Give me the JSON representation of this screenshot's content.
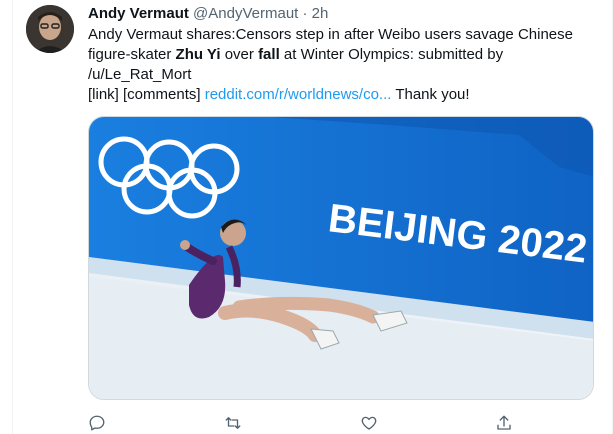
{
  "tweet": {
    "author_name": "Andy Vermaut",
    "author_handle": "@AndyVermaut",
    "separator": "·",
    "time": "2h",
    "text_part1": "Andy Vermaut shares:Censors step in after Weibo users savage Chinese figure-skater ",
    "bold1": "Zhu Yi",
    "text_part2": " over ",
    "bold2": "fall",
    "text_part3": " at Winter Olympics: submitted by /u/Le_Rat_Mort",
    "text_part4": " [link] [comments] ",
    "link_text": "reddit.com/r/worldnews/co...",
    "text_part5": " Thank you!",
    "media_banner_text": "BEIJING 2022",
    "colors": {
      "link": "#1d9bf0",
      "secondary": "#536471",
      "rink_blue": "#1478d4"
    }
  },
  "actions": {
    "reply_icon": "reply-icon",
    "retweet_icon": "retweet-icon",
    "like_icon": "like-icon",
    "share_icon": "share-icon"
  }
}
